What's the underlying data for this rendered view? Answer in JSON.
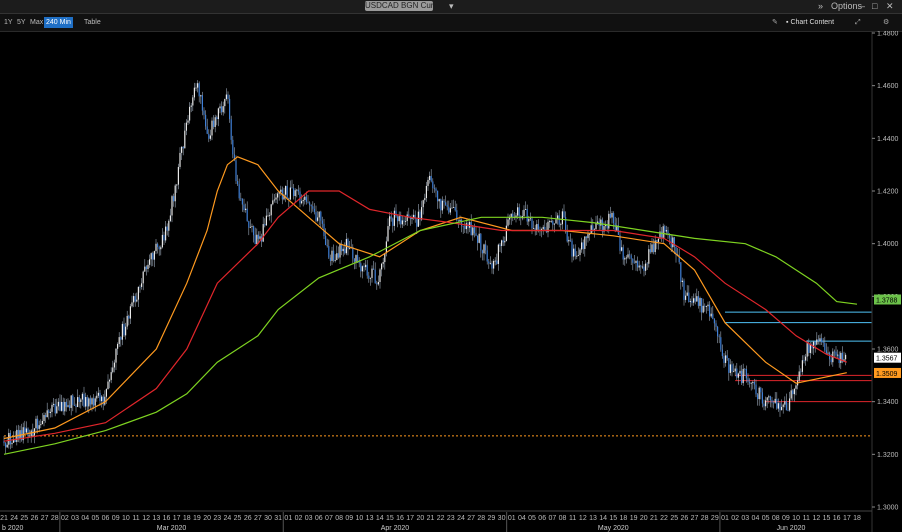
{
  "window": {
    "title": "USDCAD BGN Curncy",
    "options_label": "Options",
    "controls": [
      "–",
      "□",
      "✕"
    ]
  },
  "toolbar": {
    "ranges": [
      {
        "label": "1Y",
        "active": false
      },
      {
        "label": "5Y",
        "active": false
      },
      {
        "label": "Max",
        "active": false
      },
      {
        "label": "240 Min",
        "active": true
      },
      {
        "label": "Table",
        "active": false
      }
    ],
    "chart_content_label": "Chart Content"
  },
  "chart_data": {
    "type": "candlestick",
    "grid": false,
    "ylim": [
      1.3,
      1.48
    ],
    "y_ticks": [
      "1.4800",
      "1.4600",
      "1.4400",
      "1.4200",
      "1.4000",
      "1.3800",
      "1.3600",
      "1.3400",
      "1.3200",
      "1.3000"
    ],
    "x_ticks": {
      "Feb": [
        "21",
        "24",
        "25",
        "26",
        "27",
        "28"
      ],
      "Mar": [
        "02",
        "03",
        "04",
        "05",
        "06",
        "09",
        "10",
        "11",
        "12",
        "13",
        "16",
        "17",
        "18",
        "19",
        "20",
        "23",
        "24",
        "25",
        "26",
        "27",
        "30",
        "31"
      ],
      "Apr": [
        "01",
        "02",
        "03",
        "06",
        "07",
        "08",
        "09",
        "10",
        "13",
        "14",
        "15",
        "16",
        "17",
        "20",
        "21",
        "22",
        "23",
        "24",
        "27",
        "28",
        "29",
        "30"
      ],
      "May": [
        "01",
        "04",
        "05",
        "06",
        "07",
        "08",
        "11",
        "12",
        "13",
        "14",
        "15",
        "18",
        "19",
        "20",
        "21",
        "22",
        "25",
        "26",
        "27",
        "28",
        "29"
      ],
      "Jun": [
        "01",
        "02",
        "03",
        "04",
        "05",
        "08",
        "09",
        "10",
        "11",
        "12",
        "15",
        "16",
        "17",
        "18"
      ]
    },
    "month_labels": [
      {
        "label": "Mar 2020",
        "month": "Mar"
      },
      {
        "label": "Apr 2020",
        "month": "Apr"
      },
      {
        "label": "May 2020",
        "month": "May"
      },
      {
        "label": "Jun 2020",
        "month": "Jun"
      }
    ],
    "partial_month_label": "b 2020",
    "price_path": [
      {
        "date": "2020-02-21",
        "value": 1.325
      },
      {
        "date": "2020-02-26",
        "value": 1.33
      },
      {
        "date": "2020-02-28",
        "value": 1.338
      },
      {
        "date": "2020-03-03",
        "value": 1.34
      },
      {
        "date": "2020-03-06",
        "value": 1.342
      },
      {
        "date": "2020-03-09",
        "value": 1.36
      },
      {
        "date": "2020-03-12",
        "value": 1.39
      },
      {
        "date": "2020-03-16",
        "value": 1.405
      },
      {
        "date": "2020-03-18",
        "value": 1.445
      },
      {
        "date": "2020-03-19",
        "value": 1.462
      },
      {
        "date": "2020-03-20",
        "value": 1.44
      },
      {
        "date": "2020-03-23",
        "value": 1.45
      },
      {
        "date": "2020-03-24",
        "value": 1.455
      },
      {
        "date": "2020-03-25",
        "value": 1.42
      },
      {
        "date": "2020-03-27",
        "value": 1.4
      },
      {
        "date": "2020-03-30",
        "value": 1.41
      },
      {
        "date": "2020-03-31",
        "value": 1.42
      },
      {
        "date": "2020-04-02",
        "value": 1.418
      },
      {
        "date": "2020-04-06",
        "value": 1.41
      },
      {
        "date": "2020-04-07",
        "value": 1.395
      },
      {
        "date": "2020-04-09",
        "value": 1.4
      },
      {
        "date": "2020-04-10",
        "value": 1.39
      },
      {
        "date": "2020-04-14",
        "value": 1.387
      },
      {
        "date": "2020-04-15",
        "value": 1.41
      },
      {
        "date": "2020-04-17",
        "value": 1.408
      },
      {
        "date": "2020-04-20",
        "value": 1.41
      },
      {
        "date": "2020-04-21",
        "value": 1.425
      },
      {
        "date": "2020-04-22",
        "value": 1.415
      },
      {
        "date": "2020-04-24",
        "value": 1.41
      },
      {
        "date": "2020-04-27",
        "value": 1.405
      },
      {
        "date": "2020-04-28",
        "value": 1.4
      },
      {
        "date": "2020-04-29",
        "value": 1.39
      },
      {
        "date": "2020-05-01",
        "value": 1.41
      },
      {
        "date": "2020-05-04",
        "value": 1.412
      },
      {
        "date": "2020-05-06",
        "value": 1.405
      },
      {
        "date": "2020-05-08",
        "value": 1.41
      },
      {
        "date": "2020-05-11",
        "value": 1.395
      },
      {
        "date": "2020-05-13",
        "value": 1.405
      },
      {
        "date": "2020-05-15",
        "value": 1.41
      },
      {
        "date": "2020-05-18",
        "value": 1.395
      },
      {
        "date": "2020-05-20",
        "value": 1.39
      },
      {
        "date": "2020-05-21",
        "value": 1.4
      },
      {
        "date": "2020-05-22",
        "value": 1.405
      },
      {
        "date": "2020-05-25",
        "value": 1.4
      },
      {
        "date": "2020-05-26",
        "value": 1.38
      },
      {
        "date": "2020-05-27",
        "value": 1.378
      },
      {
        "date": "2020-05-28",
        "value": 1.376
      },
      {
        "date": "2020-05-29",
        "value": 1.37
      },
      {
        "date": "2020-06-01",
        "value": 1.355
      },
      {
        "date": "2020-06-02",
        "value": 1.35
      },
      {
        "date": "2020-06-03",
        "value": 1.35
      },
      {
        "date": "2020-06-04",
        "value": 1.345
      },
      {
        "date": "2020-06-05",
        "value": 1.34
      },
      {
        "date": "2020-06-08",
        "value": 1.34
      },
      {
        "date": "2020-06-09",
        "value": 1.338
      },
      {
        "date": "2020-06-10",
        "value": 1.345
      },
      {
        "date": "2020-06-11",
        "value": 1.36
      },
      {
        "date": "2020-06-12",
        "value": 1.362
      },
      {
        "date": "2020-06-15",
        "value": 1.36
      },
      {
        "date": "2020-06-16",
        "value": 1.355
      },
      {
        "date": "2020-06-17",
        "value": 1.357
      }
    ],
    "moving_averages": [
      {
        "color": "#ff9a1f",
        "points": [
          {
            "date": "2020-02-21",
            "value": 1.326
          },
          {
            "date": "2020-02-28",
            "value": 1.33
          },
          {
            "date": "2020-03-06",
            "value": 1.34
          },
          {
            "date": "2020-03-13",
            "value": 1.36
          },
          {
            "date": "2020-03-18",
            "value": 1.385
          },
          {
            "date": "2020-03-20",
            "value": 1.405
          },
          {
            "date": "2020-03-23",
            "value": 1.42
          },
          {
            "date": "2020-03-24",
            "value": 1.43
          },
          {
            "date": "2020-03-25",
            "value": 1.433
          },
          {
            "date": "2020-03-27",
            "value": 1.43
          },
          {
            "date": "2020-03-31",
            "value": 1.42
          },
          {
            "date": "2020-04-03",
            "value": 1.41
          },
          {
            "date": "2020-04-08",
            "value": 1.4
          },
          {
            "date": "2020-04-14",
            "value": 1.395
          },
          {
            "date": "2020-04-20",
            "value": 1.405
          },
          {
            "date": "2020-04-24",
            "value": 1.41
          },
          {
            "date": "2020-05-01",
            "value": 1.405
          },
          {
            "date": "2020-05-08",
            "value": 1.405
          },
          {
            "date": "2020-05-15",
            "value": 1.403
          },
          {
            "date": "2020-05-22",
            "value": 1.4
          },
          {
            "date": "2020-05-27",
            "value": 1.39
          },
          {
            "date": "2020-06-01",
            "value": 1.37
          },
          {
            "date": "2020-06-05",
            "value": 1.355
          },
          {
            "date": "2020-06-10",
            "value": 1.347
          },
          {
            "date": "2020-06-17",
            "value": 1.351
          }
        ]
      },
      {
        "color": "#e0262b",
        "points": [
          {
            "date": "2020-02-21",
            "value": 1.325
          },
          {
            "date": "2020-02-28",
            "value": 1.328
          },
          {
            "date": "2020-03-06",
            "value": 1.332
          },
          {
            "date": "2020-03-13",
            "value": 1.345
          },
          {
            "date": "2020-03-18",
            "value": 1.36
          },
          {
            "date": "2020-03-23",
            "value": 1.385
          },
          {
            "date": "2020-03-27",
            "value": 1.4
          },
          {
            "date": "2020-03-31",
            "value": 1.41
          },
          {
            "date": "2020-04-03",
            "value": 1.42
          },
          {
            "date": "2020-04-08",
            "value": 1.42
          },
          {
            "date": "2020-04-13",
            "value": 1.413
          },
          {
            "date": "2020-04-17",
            "value": 1.41
          },
          {
            "date": "2020-04-23",
            "value": 1.408
          },
          {
            "date": "2020-04-30",
            "value": 1.405
          },
          {
            "date": "2020-05-08",
            "value": 1.405
          },
          {
            "date": "2020-05-15",
            "value": 1.405
          },
          {
            "date": "2020-05-22",
            "value": 1.402
          },
          {
            "date": "2020-05-27",
            "value": 1.395
          },
          {
            "date": "2020-06-01",
            "value": 1.385
          },
          {
            "date": "2020-06-05",
            "value": 1.375
          },
          {
            "date": "2020-06-10",
            "value": 1.365
          },
          {
            "date": "2020-06-15",
            "value": 1.358
          },
          {
            "date": "2020-06-17",
            "value": 1.355
          }
        ]
      },
      {
        "color": "#7ed321",
        "points": [
          {
            "date": "2020-02-21",
            "value": 1.32
          },
          {
            "date": "2020-02-28",
            "value": 1.324
          },
          {
            "date": "2020-03-06",
            "value": 1.329
          },
          {
            "date": "2020-03-13",
            "value": 1.336
          },
          {
            "date": "2020-03-18",
            "value": 1.343
          },
          {
            "date": "2020-03-23",
            "value": 1.355
          },
          {
            "date": "2020-03-27",
            "value": 1.365
          },
          {
            "date": "2020-03-31",
            "value": 1.375
          },
          {
            "date": "2020-04-06",
            "value": 1.387
          },
          {
            "date": "2020-04-13",
            "value": 1.395
          },
          {
            "date": "2020-04-20",
            "value": 1.405
          },
          {
            "date": "2020-04-28",
            "value": 1.41
          },
          {
            "date": "2020-05-06",
            "value": 1.41
          },
          {
            "date": "2020-05-13",
            "value": 1.408
          },
          {
            "date": "2020-05-20",
            "value": 1.405
          },
          {
            "date": "2020-05-27",
            "value": 1.402
          },
          {
            "date": "2020-06-03",
            "value": 1.4
          },
          {
            "date": "2020-06-08",
            "value": 1.395
          },
          {
            "date": "2020-06-12",
            "value": 1.385
          },
          {
            "date": "2020-06-16",
            "value": 1.378
          },
          {
            "date": "2020-06-18",
            "value": 1.377
          }
        ]
      }
    ],
    "price_badges": [
      {
        "label": "1.3788",
        "value": 1.3788,
        "bg": "#6cc24a",
        "fg": "#000"
      },
      {
        "label": "1.3567",
        "value": 1.3567,
        "bg": "#ffffff",
        "fg": "#000"
      },
      {
        "label": "1.3509",
        "value": 1.3509,
        "bg": "#ff9a1f",
        "fg": "#000"
      }
    ],
    "horizontal_lines": [
      {
        "value": 1.374,
        "color": "#4fc3f7",
        "from": "2020-06-01",
        "dashed": false
      },
      {
        "value": 1.37,
        "color": "#4fc3f7",
        "from": "2020-06-01",
        "dashed": false
      },
      {
        "value": 1.363,
        "color": "#4fc3f7",
        "from": "2020-06-11",
        "dashed": false
      },
      {
        "value": 1.35,
        "color": "#e0262b",
        "from": "2020-06-02",
        "dashed": false
      },
      {
        "value": 1.348,
        "color": "#e0262b",
        "from": "2020-06-02",
        "dashed": false
      },
      {
        "value": 1.34,
        "color": "#e0262b",
        "from": "2020-06-05",
        "dashed": false
      },
      {
        "value": 1.327,
        "color": "#ff9a1f",
        "from": "2020-02-21",
        "dashed": true
      }
    ]
  }
}
